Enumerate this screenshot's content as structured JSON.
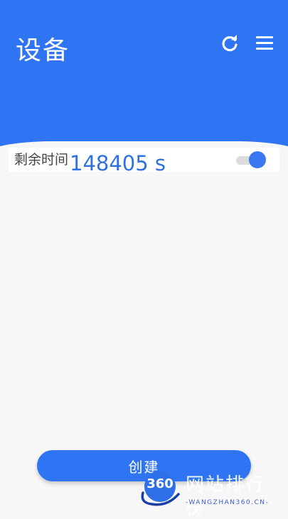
{
  "header": {
    "title": "设备",
    "refresh_icon": "refresh-icon",
    "menu_icon": "hamburger-menu-icon"
  },
  "timer": {
    "label": "剩余时间",
    "value": "148405 s",
    "toggle_on": true
  },
  "actions": {
    "create_label": "创建"
  },
  "watermark": {
    "logo_text": "360",
    "cn_text": "网站排行榜",
    "en_text": "-WANGZHAN360.CN-"
  },
  "colors": {
    "primary": "#2f75f3",
    "value_text": "#3070e0",
    "background": "#f7f7f7"
  }
}
